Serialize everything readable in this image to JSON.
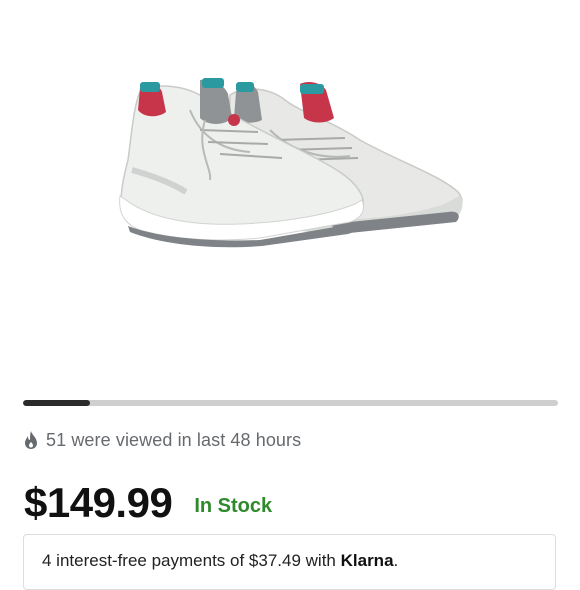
{
  "product": {
    "image_alt": "white sneakers"
  },
  "carousel": {
    "progress_fraction": 0.125
  },
  "views": {
    "icon": "flame-icon",
    "text": "51 were viewed in last 48 hours"
  },
  "pricing": {
    "price": "$149.99",
    "stock_status": "In Stock",
    "stock_color": "#2f8a2c"
  },
  "klarna": {
    "prefix": "4 interest-free payments of $37.49 with ",
    "brand": "Klarna",
    "suffix": "."
  }
}
